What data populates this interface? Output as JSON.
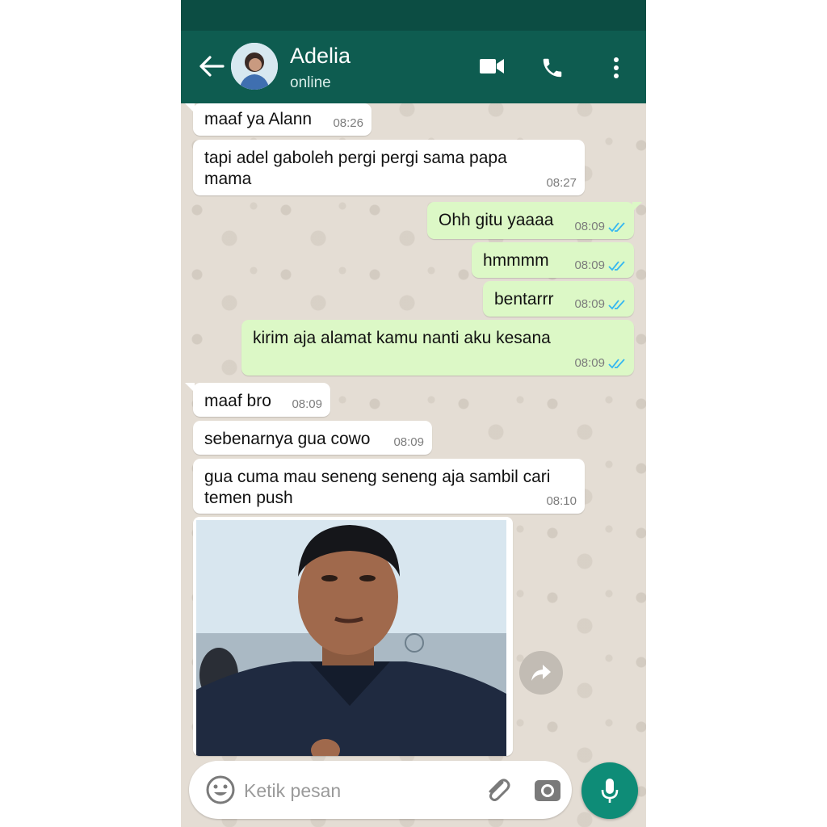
{
  "header": {
    "contact_name": "Adelia",
    "contact_status": "online",
    "icons": [
      "back-arrow-icon",
      "video-call-icon",
      "phone-icon",
      "more-vert-icon"
    ]
  },
  "messages": [
    {
      "direction": "in",
      "text": "maaf ya Alann",
      "time": "08:26"
    },
    {
      "direction": "in",
      "text": "tapi adel gaboleh pergi pergi sama papa\nmama",
      "time": "08:27"
    },
    {
      "direction": "out",
      "text": "Ohh gitu yaaaa",
      "time": "08:09",
      "status": "read"
    },
    {
      "direction": "out",
      "text": "hmmmm",
      "time": "08:09",
      "status": "read"
    },
    {
      "direction": "out",
      "text": "bentarrr",
      "time": "08:09",
      "status": "read"
    },
    {
      "direction": "out",
      "text": "kirim aja alamat kamu nanti aku kesana",
      "time": "08:09",
      "status": "read"
    },
    {
      "direction": "in",
      "text": "maaf bro",
      "time": "08:09"
    },
    {
      "direction": "in",
      "text": "sebenarnya gua cowo",
      "time": "08:09"
    },
    {
      "direction": "in",
      "text": "gua cuma mau seneng seneng aja sambil cari\ntemen push",
      "time": "08:10"
    }
  ],
  "photo_message": {
    "direction": "in",
    "type": "image"
  },
  "composer": {
    "placeholder": "Ketik pesan",
    "icons": [
      "emoji-icon",
      "attachment-icon",
      "camera-icon",
      "mic-icon"
    ]
  },
  "colors": {
    "header": "#0e5c50",
    "status_bar": "#0c4d43",
    "outgoing_bubble": "#dcf8c6",
    "incoming_bubble": "#ffffff",
    "read_ticks": "#34b7f1",
    "mic_button": "#0e8c77"
  }
}
